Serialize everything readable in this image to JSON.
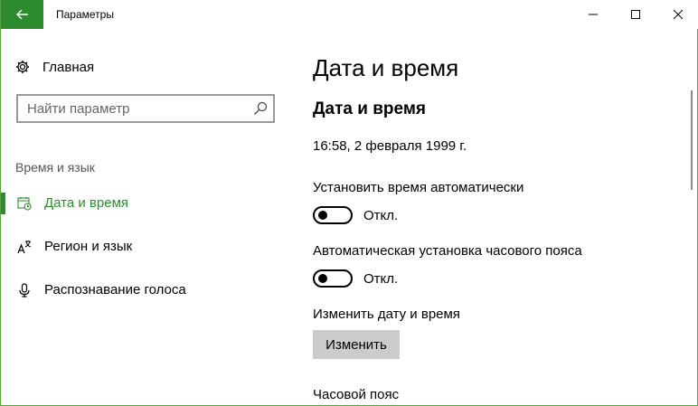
{
  "window": {
    "title": "Параметры",
    "accent_color": "#2e8a2e"
  },
  "sidebar": {
    "home_label": "Главная",
    "search_placeholder": "Найти параметр",
    "section_title": "Время и язык",
    "items": [
      {
        "label": "Дата и время",
        "icon": "calendar-clock-icon",
        "active": true
      },
      {
        "label": "Регион и язык",
        "icon": "language-icon",
        "active": false
      },
      {
        "label": "Распознавание голоса",
        "icon": "microphone-icon",
        "active": false
      }
    ]
  },
  "main": {
    "page_title": "Дата и время",
    "section_heading": "Дата и время",
    "current_datetime": "16:58, 2 февраля 1999 г.",
    "auto_time": {
      "label": "Установить время автоматически",
      "state": "Откл.",
      "on": false
    },
    "auto_timezone": {
      "label": "Автоматическая установка часового пояса",
      "state": "Откл.",
      "on": false
    },
    "change_datetime": {
      "label": "Изменить дату и время",
      "button": "Изменить"
    },
    "timezone_label": "Часовой пояс"
  }
}
